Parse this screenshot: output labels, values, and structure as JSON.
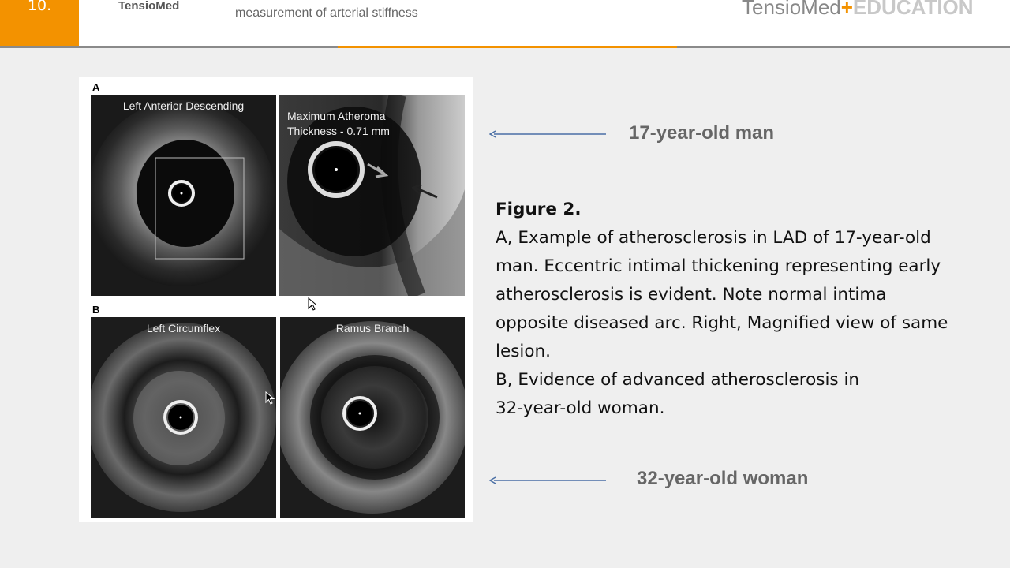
{
  "header": {
    "slide_number": "10.",
    "brand": "TensioMed",
    "subtitle": "measurement of arterial stiffness",
    "logo_main": "TensioMed",
    "logo_plus": "+",
    "logo_edu": "EDUCATION",
    "colors": {
      "accent": "#f39200",
      "header_bg": "#ffffff",
      "slide_bg": "#efefef"
    }
  },
  "figure": {
    "panel_a_letter": "A",
    "panel_b_letter": "B",
    "images": [
      {
        "label": "Left Anterior Descending"
      },
      {
        "label_line1": "Maximum Atheroma",
        "label_line2": "Thickness - 0.71 mm"
      },
      {
        "label": "Left Circumflex"
      },
      {
        "label": "Ramus Branch"
      }
    ]
  },
  "annotations": {
    "top_note": "17-year-old man",
    "bottom_note": "32-year-old woman",
    "arrow_color": "#4a6fa5"
  },
  "caption": {
    "title": "Figure 2.",
    "lines": [
      "A, Example of atherosclerosis in LAD of 17-year-old",
      "man. Eccentric intimal thickening representing early",
      "atherosclerosis is evident. Note normal intima",
      "opposite diseased arc. Right, Magnified view of same",
      "lesion.",
      "B, Evidence of advanced atherosclerosis in",
      "32-year-old woman."
    ]
  }
}
